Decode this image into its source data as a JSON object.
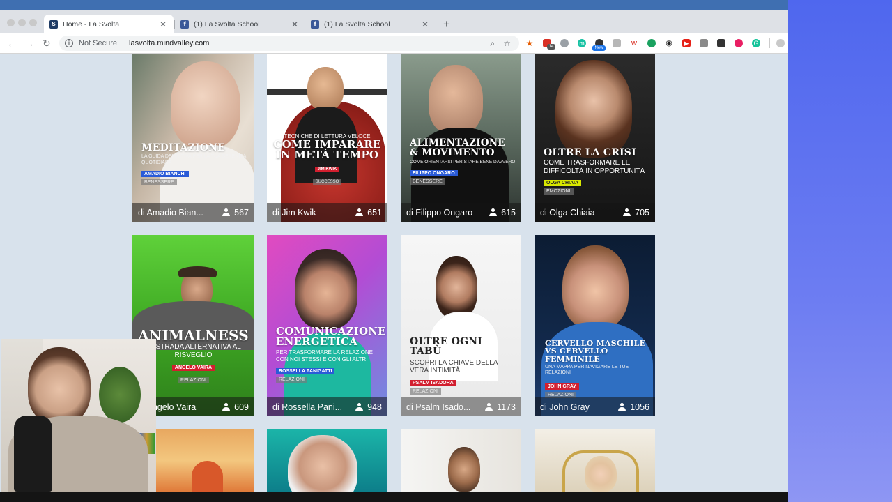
{
  "browser": {
    "tabs": [
      {
        "title": "Home - La Svolta",
        "favicon": "S",
        "active": true
      },
      {
        "title": "(1) La Svolta School",
        "favicon": "f",
        "active": false
      },
      {
        "title": "(1) La Svolta School",
        "favicon": "f",
        "active": false
      }
    ],
    "new_tab": "+",
    "security": "Not Secure",
    "url": "lasvolta.mindvalley.com",
    "ext_badge_a": "14",
    "ext_badge_b": "New"
  },
  "colors": {
    "chrome_tabbar": "#dee1e6",
    "page_bg": "#d8e2ec",
    "presenter_blue": "#2a5bd7",
    "presenter_red": "#d21f2f",
    "presenter_yellow": "#d8e800",
    "desktop_blue": "#5b6ff0"
  },
  "courses": [
    {
      "headline": "MEDITAZIONE",
      "subtitle": "LA GUIDA DEFINITIVA PER LA TUA SERENITÀ QUOTIDIANA",
      "presenter": "AMADIO BIANCHI",
      "category": "BENESSERE",
      "author": "di Amadio Bian...",
      "count": "567"
    },
    {
      "headline_top": "TECNICHE DI LETTURA VELOCE",
      "headline": "COME IMPARARE IN METÀ TEMPO",
      "presenter": "JIM KWIK",
      "category": "SUCCESSO",
      "author": "di Jim Kwik",
      "count": "651"
    },
    {
      "headline": "ALIMENTAZIONE & MOVIMENTO",
      "subtitle": "COME ORIENTARSI PER STARE BENE DAVVERO",
      "presenter": "FILIPPO ONGARO",
      "category": "BENESSERE",
      "author": "di Filippo Ongaro",
      "count": "615"
    },
    {
      "headline": "OLTRE LA CRISI",
      "subtitle": "COME TRASFORMARE LE DIFFICOLTÀ IN OPPORTUNITÀ",
      "presenter": "OLGA CHIAIA",
      "category": "EMOZIONI",
      "author": "di Olga Chiaia",
      "count": "705"
    },
    {
      "headline": "ANIMALNESS",
      "subtitle": "LA STRADA ALTERNATIVA AL RISVEGLIO",
      "presenter": "ANGELO VAIRA",
      "category": "RELAZIONI",
      "author": "di Angelo Vaira",
      "count": "609"
    },
    {
      "headline": "COMUNICAZIONE ENERGETICA",
      "subtitle": "PER TRASFORMARE LA RELAZIONE CON NOI STESSI E CON GLI ALTRI",
      "presenter": "ROSSELLA PANIGATTI",
      "category": "RELAZIONI",
      "author": "di Rossella Pani...",
      "count": "948"
    },
    {
      "headline": "OLTRE OGNI TABÙ",
      "subtitle": "SCOPRI LA CHIAVE DELLA VERA INTIMITÀ",
      "presenter": "PSALM ISADORA",
      "category": "RELAZIONI",
      "author": "di Psalm Isado...",
      "count": "1173"
    },
    {
      "headline": "CERVELLO MASCHILE VS CERVELLO FEMMINILE",
      "subtitle": "UNA MAPPA PER NAVIGARE LE TUE RELAZIONI",
      "presenter": "JOHN GRAY",
      "category": "RELAZIONI",
      "author": "di John Gray",
      "count": "1056"
    }
  ]
}
